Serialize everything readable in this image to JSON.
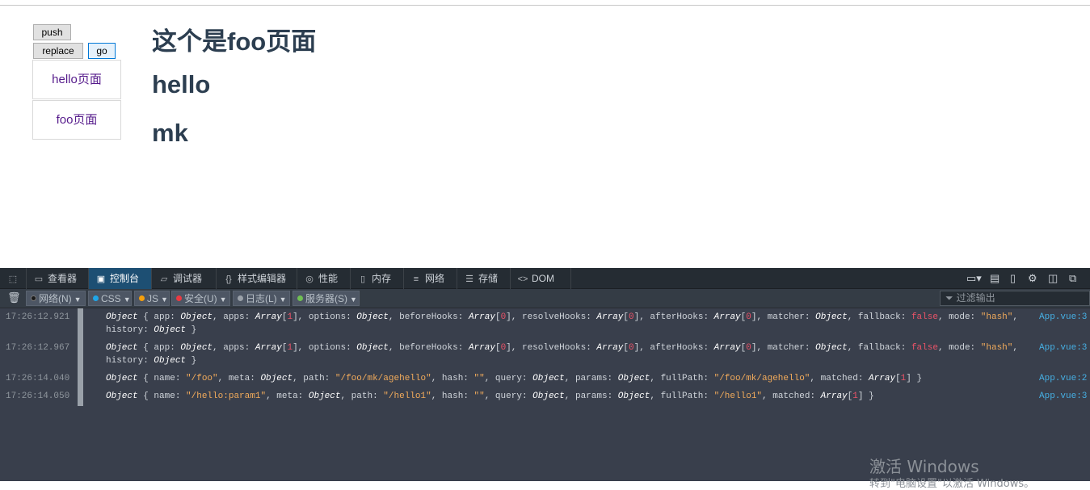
{
  "app": {
    "buttons": {
      "push": "push",
      "replace": "replace",
      "go": "go"
    },
    "nav": [
      "hello页面",
      "foo页面"
    ],
    "heading": "这个是foo页面",
    "sub1": "hello",
    "sub2": "mk"
  },
  "devtools": {
    "tabs": [
      {
        "label": "查看器",
        "icon": "inspector-icon"
      },
      {
        "label": "控制台",
        "icon": "console-icon"
      },
      {
        "label": "调试器",
        "icon": "debugger-icon"
      },
      {
        "label": "样式编辑器",
        "icon": "style-editor-icon"
      },
      {
        "label": "性能",
        "icon": "performance-icon"
      },
      {
        "label": "内存",
        "icon": "memory-icon"
      },
      {
        "label": "网络",
        "icon": "network-icon"
      },
      {
        "label": "存储",
        "icon": "storage-icon"
      },
      {
        "label": "DOM",
        "icon": "dom-icon"
      }
    ],
    "active_tab": "控制台",
    "filters": [
      {
        "label": "网络(N)",
        "color": "#1a1a1a"
      },
      {
        "label": "CSS",
        "color": "#1fa6e8"
      },
      {
        "label": "JS",
        "color": "#f59f0b"
      },
      {
        "label": "安全(U)",
        "color": "#eb3941"
      },
      {
        "label": "日志(L)",
        "color": "#9aa1a9"
      },
      {
        "label": "服务器(S)",
        "color": "#70bf53"
      }
    ],
    "filter_placeholder": "过滤输出",
    "logs": [
      {
        "time": "17:26:12.921",
        "source": "App.vue:3"
      },
      {
        "time": "17:26:12.967",
        "source": "App.vue:3"
      },
      {
        "time": "17:26:14.040",
        "source": "App.vue:2"
      },
      {
        "time": "17:26:14.050",
        "source": "App.vue:3"
      }
    ]
  },
  "watermark": {
    "line1": "激活 Windows",
    "line2": "转到\"电脑设置\"以激活 Windows。"
  }
}
